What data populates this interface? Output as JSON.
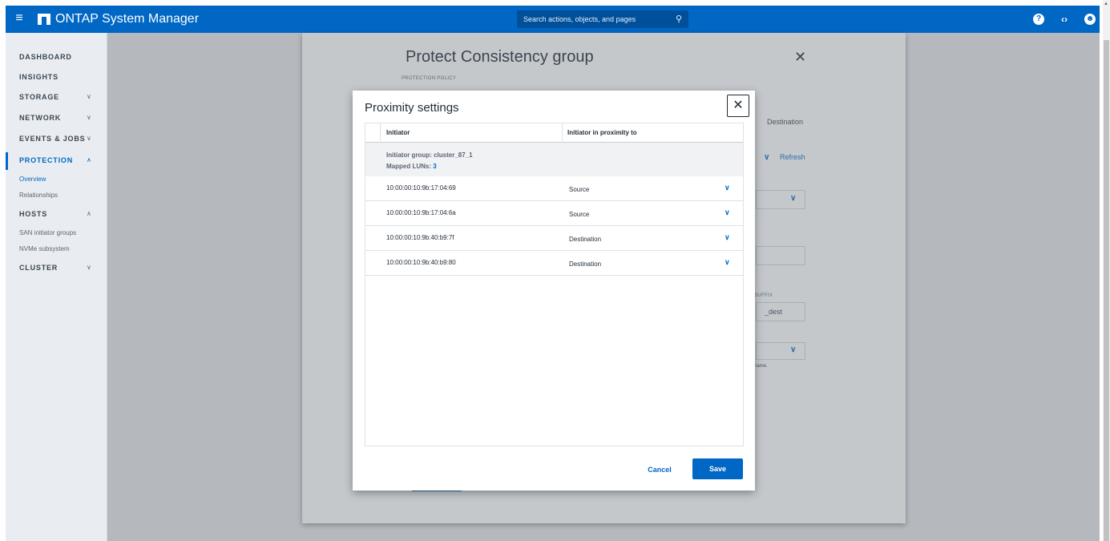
{
  "app": {
    "title": "ONTAP System Manager",
    "menu_icon": "hamburger-icon",
    "logo_icon": "netapp-logo-icon"
  },
  "header": {
    "search_placeholder": "Search actions, objects, and pages",
    "search_icon": "search-icon",
    "help_icon": "help-icon",
    "code_icon": "code-icon",
    "user_icon": "user-icon"
  },
  "sidebar": {
    "items": [
      {
        "label": "DASHBOARD"
      },
      {
        "label": "INSIGHTS"
      },
      {
        "label": "STORAGE",
        "expandable": true
      },
      {
        "label": "NETWORK",
        "expandable": true
      },
      {
        "label": "EVENTS & JOBS",
        "expandable": true
      },
      {
        "label": "PROTECTION",
        "expandable": true,
        "expanded": true,
        "active": true
      },
      {
        "label": "HOSTS",
        "expandable": true,
        "expanded": true
      },
      {
        "label": "CLUSTER",
        "expandable": true
      }
    ],
    "protection_children": [
      "Overview",
      "Relationships"
    ],
    "hosts_children": [
      "SAN initiator groups",
      "NVMe subsystem"
    ]
  },
  "background_panel": {
    "title": "Protect Consistency group",
    "protection_policy_label": "PROTECTION POLICY",
    "destination_label": "Destination",
    "refresh_label": "Refresh",
    "suffix_label": "SUFFIX",
    "suffix_value": "_dest",
    "hint_fragment": "name."
  },
  "dialog": {
    "title": "Proximity settings",
    "columns": [
      "Initiator",
      "Initiator in proximity to"
    ],
    "group": {
      "label": "Initiator group: cluster_87_1",
      "mapped_luns_label": "Mapped LUNs:",
      "mapped_luns_count": "3"
    },
    "rows": [
      {
        "initiator": "10:00:00:10:9b:17:04:69",
        "proximity": "Source"
      },
      {
        "initiator": "10:00:00:10:9b:17:04:6a",
        "proximity": "Source"
      },
      {
        "initiator": "10:00:00:10:9b:40:b9:7f",
        "proximity": "Destination"
      },
      {
        "initiator": "10:00:00:10:9b:40:b9:80",
        "proximity": "Destination"
      }
    ],
    "cancel_label": "Cancel",
    "save_label": "Save"
  },
  "colors": {
    "brand": "#0067c5",
    "sidebar_bg": "#e9edf1",
    "text": "#1f2a36"
  }
}
